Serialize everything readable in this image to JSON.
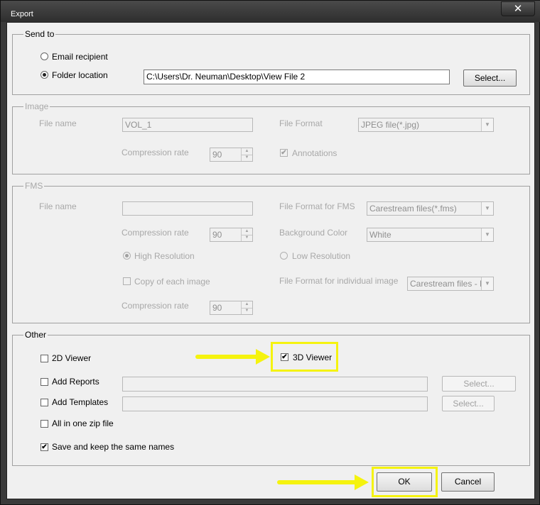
{
  "window": {
    "title": "Export",
    "close_glyph": "✕"
  },
  "send_to": {
    "legend": "Send to",
    "email_label": "Email recipient",
    "folder_label": "Folder location",
    "folder_value": "C:\\Users\\Dr. Neuman\\Desktop\\View File 2",
    "select_label": "Select...",
    "selected": "folder"
  },
  "image": {
    "legend": "Image",
    "file_name_label": "File name",
    "file_name_value": "VOL_1",
    "file_format_label": "File Format",
    "file_format_value": "JPEG file(*.jpg)",
    "compression_label": "Compression rate",
    "compression_value": "90",
    "annotations_label": "Annotations",
    "annotations_checked": true
  },
  "fms": {
    "legend": "FMS",
    "file_name_label": "File name",
    "file_name_value": "",
    "file_format_label": "File Format for FMS",
    "file_format_value": "Carestream files(*.fms)",
    "compression_label": "Compression rate",
    "compression_value": "90",
    "background_label": "Background Color",
    "background_value": "White",
    "high_res_label": "High Resolution",
    "low_res_label": "Low Resolution",
    "copy_label": "Copy of each image",
    "individual_format_label": "File Format for individual image",
    "individual_format_value": "Carestream files - Lar",
    "compression2_label": "Compression rate",
    "compression2_value": "90"
  },
  "other": {
    "legend": "Other",
    "viewer2d_label": "2D Viewer",
    "viewer2d_checked": false,
    "viewer3d_label": "3D Viewer",
    "viewer3d_checked": true,
    "add_reports_label": "Add Reports",
    "add_templates_label": "Add Templates",
    "zip_label": "All in one zip file",
    "save_names_label": "Save and keep the same names",
    "save_names_checked": true,
    "select_label": "Select..."
  },
  "footer": {
    "ok_label": "OK",
    "cancel_label": "Cancel"
  },
  "check_glyph": "✔",
  "colors": {
    "highlight": "#f5f30f",
    "title_bar": "#3a3a3a",
    "dialog_bg": "#f0f0f0"
  }
}
